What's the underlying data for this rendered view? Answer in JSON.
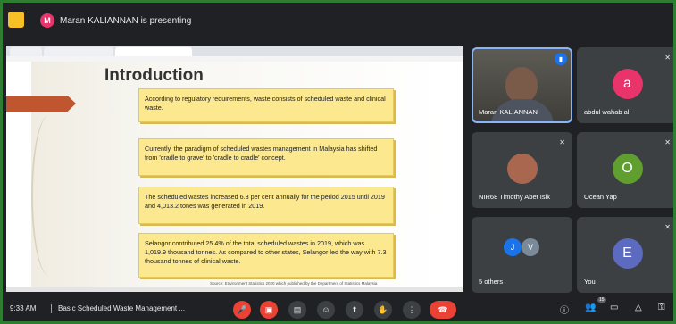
{
  "presenter": {
    "avatar_initial": "M",
    "label": "Maran KALIANNAN is presenting"
  },
  "browser": {
    "tabs": [
      "",
      "",
      ""
    ]
  },
  "slide": {
    "title": "Introduction",
    "bullets": [
      "According to regulatory requirements, waste consists of scheduled waste and clinical waste.",
      "Currently, the paradigm of scheduled wastes management in Malaysia has shifted from 'cradle to grave' to 'cradle to cradle' concept.",
      "The scheduled wastes increased 6.3 per cent annually for the period 2015 until 2019 and 4,013.2 tones was generated in 2019.",
      "Selangor contributed 25.4% of the total scheduled wastes in 2019, which was 1,019.9 thousand tonnes. As compared to other states, Selangor led the way with 7.3 thousand tonnes of clinical waste."
    ],
    "source": "Source: Environment Statistics 2020 which published by the Department of Statistics Malaysia"
  },
  "participants": [
    {
      "name": "Maran KALIANNAN",
      "initial": "",
      "color": "",
      "speaking": true
    },
    {
      "name": "abdul wahab ali",
      "initial": "a",
      "color": "#e8336b"
    },
    {
      "name": "NIR68 Timothy Abet Isik",
      "initial": "",
      "color": ""
    },
    {
      "name": "Ocean Yap",
      "initial": "O",
      "color": "#5f9e2f"
    },
    {
      "name": "5 others",
      "initials": [
        "J",
        "V"
      ],
      "colors": [
        "#1a73e8",
        "#7b8a99"
      ]
    },
    {
      "name": "You",
      "initial": "E",
      "color": "#5c6bc0"
    }
  ],
  "bottombar": {
    "time": "9:33 AM",
    "meeting_title": "Basic Scheduled Waste Management ...",
    "participant_count": "15"
  },
  "icons": {
    "mic_off": "mic-off-icon",
    "cam_off": "camera-off-icon",
    "captions": "captions-icon",
    "emoji": "emoji-icon",
    "present": "present-icon",
    "hand": "raise-hand-icon",
    "more": "more-icon",
    "end_call": "end-call-icon"
  }
}
